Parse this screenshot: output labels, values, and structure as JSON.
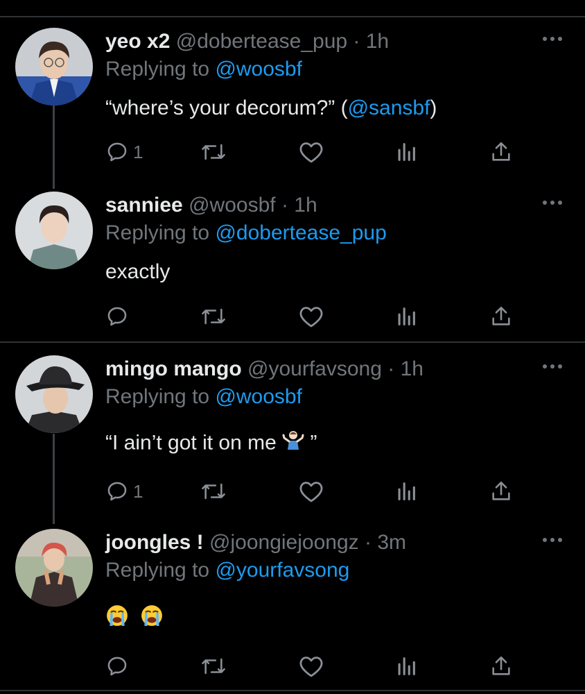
{
  "tweets": [
    {
      "name": "yeo x2",
      "handle": "@dobertease_pup",
      "dot": "·",
      "time": "1h",
      "replying_prefix": "Replying to",
      "replying_to": "@woosbf",
      "text_pre": "“where’s your decorum?” (",
      "text_mention": "@sansbf",
      "text_post": ")",
      "reply_count": "1"
    },
    {
      "name": "sanniee",
      "handle": "@woosbf",
      "dot": "·",
      "time": "1h",
      "replying_prefix": "Replying to",
      "replying_to": "@dobertease_pup",
      "text": "exactly",
      "reply_count": ""
    },
    {
      "name": "mingo mango",
      "handle": "@yourfavsong",
      "dot": "·",
      "time": "1h",
      "replying_prefix": "Replying to",
      "replying_to": "@woosbf",
      "text_pre": "“I ain’t got it on me ",
      "text_post": " ”",
      "emoji": "person-shrugging-emoji",
      "reply_count": "1"
    },
    {
      "name": "joongles !",
      "handle": "@joongiejoongz",
      "dot": "·",
      "time": "3m",
      "replying_prefix": "Replying to",
      "replying_to": "@yourfavsong",
      "emoji": "loudly-crying-face-emoji",
      "reply_count": ""
    }
  ],
  "colors": {
    "background": "#000000",
    "text": "#e7e9ea",
    "muted": "#71767b",
    "link": "#1d9bf0",
    "divider": "#2f3336",
    "thread_line": "#3e4144"
  },
  "icons": [
    "more-icon",
    "reply-icon",
    "retweet-icon",
    "like-icon",
    "analytics-icon",
    "share-icon"
  ]
}
